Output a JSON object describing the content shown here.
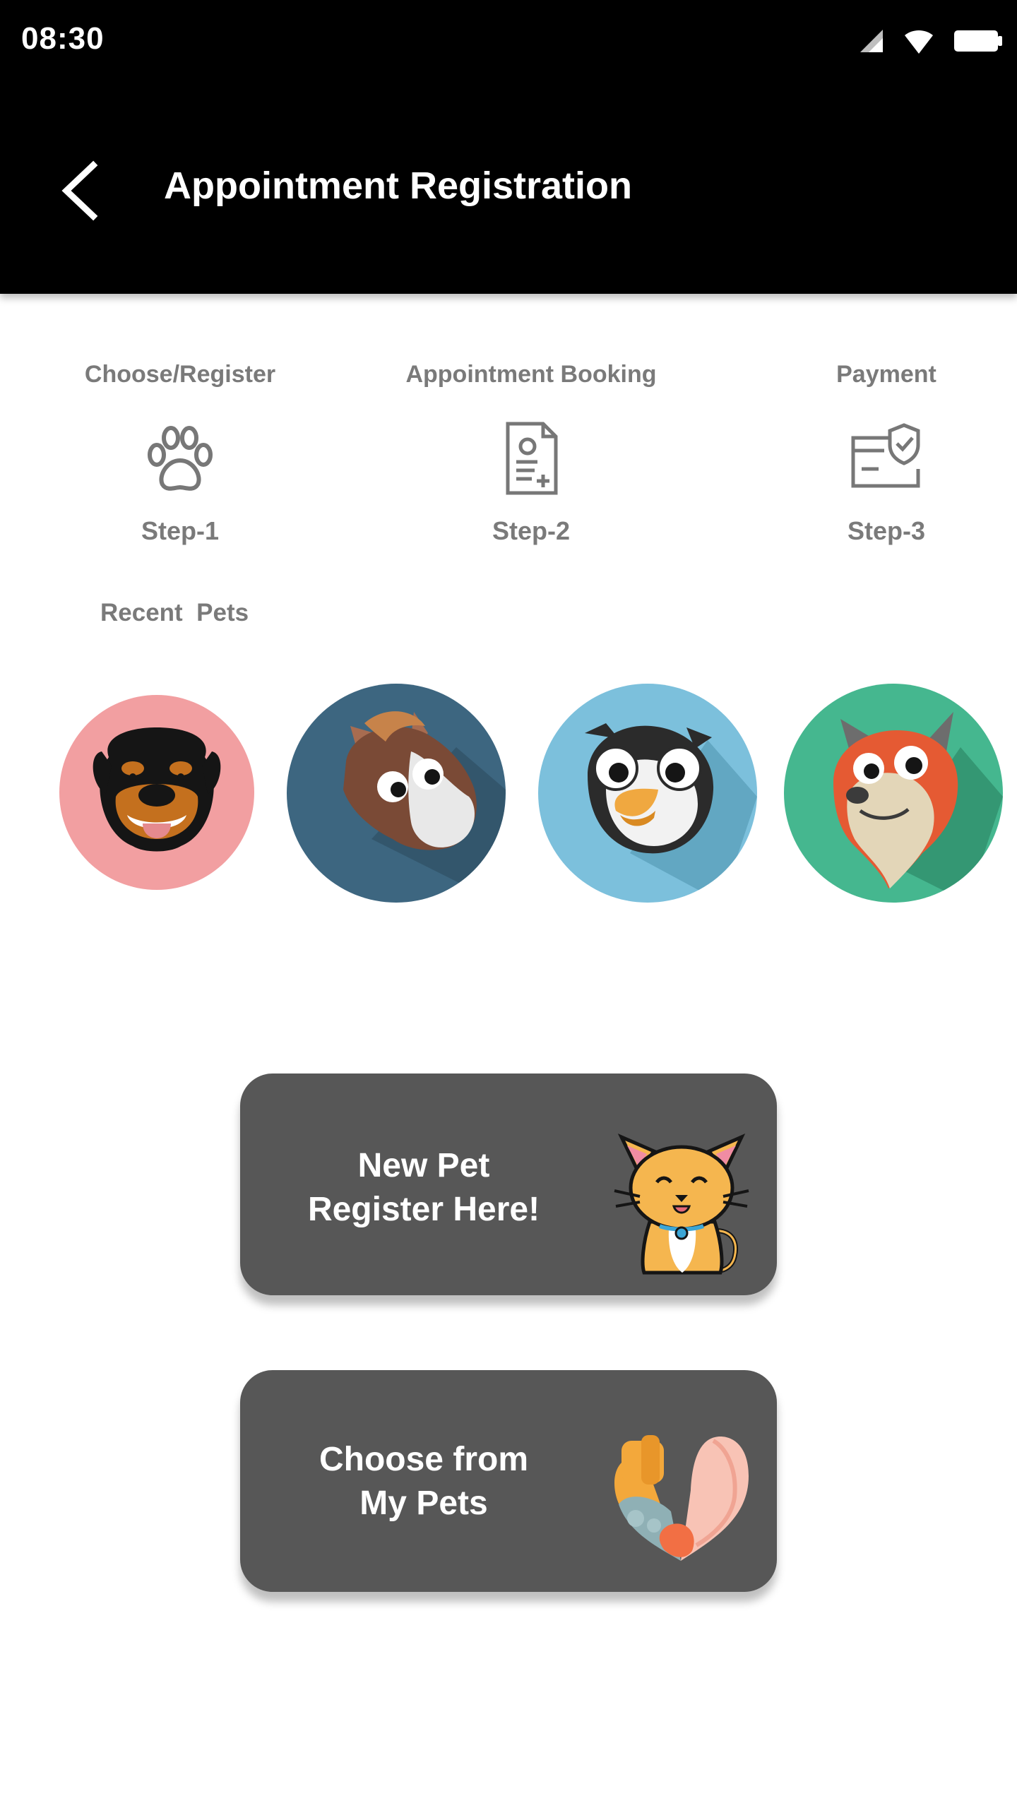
{
  "status_bar": {
    "time": "08:30",
    "icons": [
      "signal-icon",
      "wifi-icon",
      "battery-icon"
    ]
  },
  "app_bar": {
    "title": "Appointment Registration",
    "back_icon": "chevron-left-icon"
  },
  "steps": [
    {
      "title": "Choose/Register",
      "label": "Step-1",
      "icon": "paw-icon"
    },
    {
      "title": "Appointment Booking",
      "label": "Step-2",
      "icon": "document-icon"
    },
    {
      "title": "Payment",
      "label": "Step-3",
      "icon": "payment-verified-icon"
    }
  ],
  "recent": {
    "title": "Recent  Pets",
    "pets": [
      {
        "name": "rottweiler",
        "color": "#F29FA1"
      },
      {
        "name": "horse",
        "color": "#3D6680"
      },
      {
        "name": "penguin",
        "color": "#7CC0DC"
      },
      {
        "name": "fox",
        "color": "#45B78F"
      }
    ]
  },
  "actions": {
    "new_pet": {
      "line1": "New Pet",
      "line2": "Register Here!",
      "icon": "cat-icon"
    },
    "choose_pet": {
      "line1": "Choose from",
      "line2": "My Pets",
      "icon": "paw-heart-icon"
    }
  },
  "colors": {
    "bar": "#000000",
    "step_text": "#7A7A7A",
    "button": "#575757"
  }
}
